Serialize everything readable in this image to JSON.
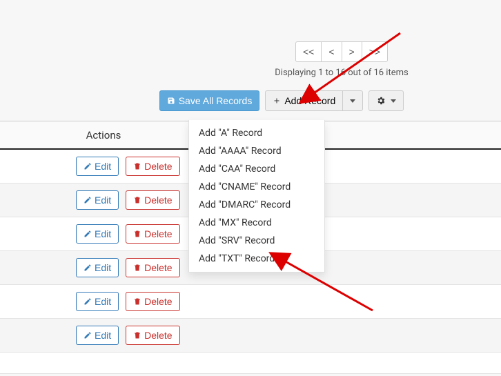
{
  "pager": {
    "first": "<<",
    "prev": "<",
    "next": ">",
    "last": ">>"
  },
  "status": "Displaying 1 to 16 out of 16 items",
  "toolbar": {
    "save_label": "Save All Records",
    "add_label": "Add Record"
  },
  "columns": {
    "actions": "Actions"
  },
  "dropdown": {
    "items": [
      {
        "label": "Add \"A\" Record"
      },
      {
        "label": "Add \"AAAA\" Record"
      },
      {
        "label": "Add \"CAA\" Record"
      },
      {
        "label": "Add \"CNAME\" Record"
      },
      {
        "label": "Add \"DMARC\" Record"
      },
      {
        "label": "Add \"MX\" Record"
      },
      {
        "label": "Add \"SRV\" Record"
      },
      {
        "label": "Add \"TXT\" Record"
      }
    ]
  },
  "row_actions": {
    "edit": "Edit",
    "delete": "Delete"
  }
}
